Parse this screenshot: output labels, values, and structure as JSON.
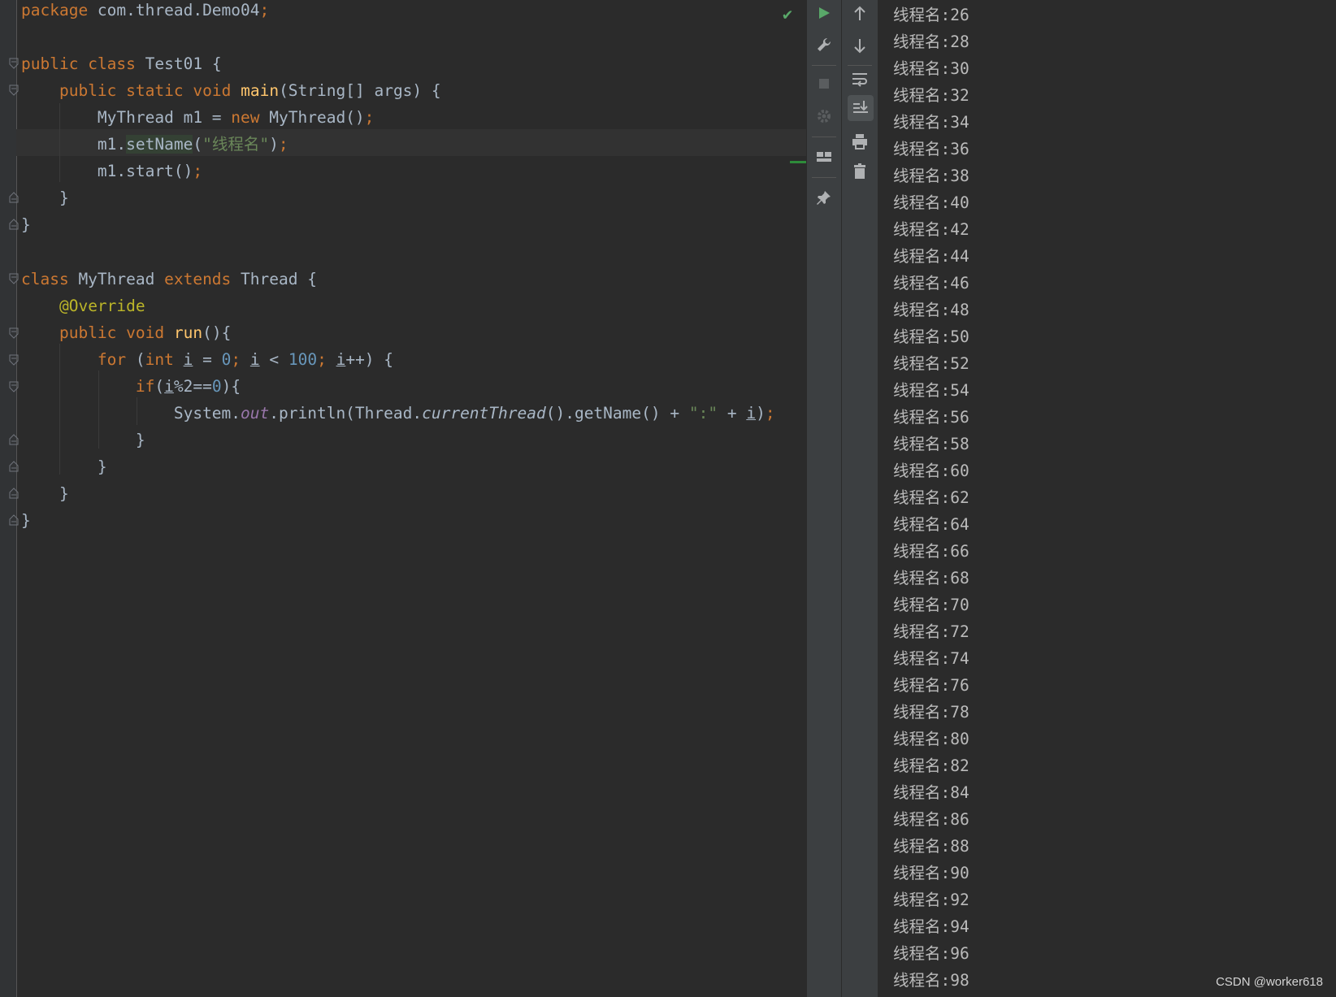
{
  "editor": {
    "lines": [
      {
        "id": "l1"
      },
      {
        "id": "l3"
      }
    ],
    "tokens": {
      "package_kw": "package",
      "package_name": " com.thread.Demo04",
      "semi": ";",
      "public": "public",
      "class": "class",
      "static": "static",
      "void": "void",
      "new": "new",
      "extends": "extends",
      "for": "for",
      "int": "int",
      "if": "if",
      "test01": " Test01 {",
      "main": "main",
      "main_args": "(String[] args) {",
      "mythread_decl": "MyThread m1 = ",
      "mythread_ctor": " MyThread()",
      "m1_dot": "m1.",
      "setName": "setName",
      "paren_open": "(",
      "thread_name_str": "\"线程名\"",
      "paren_close_semi": ")",
      "m1_start": "m1.start()",
      "close_brace": "}",
      "mythread_class": " MyThread ",
      "thread_brace": " Thread {",
      "override": "@Override",
      "run": "run",
      "run_paren": "(){",
      "for_open": " (",
      "i": "i",
      "eq": " = ",
      "zero": "0",
      "lt": " < ",
      "hundred": "100",
      "inc": "++) {",
      "if_open": "(",
      "mod": "%2==",
      "if_close": "){",
      "system": "System.",
      "out": "out",
      "println": ".println(Thread.",
      "currentThread": "currentThread",
      "getname": "().getName() + ",
      "colon_str": "\":\"",
      "plus": " + ",
      "close_paren": ")"
    }
  },
  "console": {
    "lines": [
      "线程名:26",
      "线程名:28",
      "线程名:30",
      "线程名:32",
      "线程名:34",
      "线程名:36",
      "线程名:38",
      "线程名:40",
      "线程名:42",
      "线程名:44",
      "线程名:46",
      "线程名:48",
      "线程名:50",
      "线程名:52",
      "线程名:54",
      "线程名:56",
      "线程名:58",
      "线程名:60",
      "线程名:62",
      "线程名:64",
      "线程名:66",
      "线程名:68",
      "线程名:70",
      "线程名:72",
      "线程名:74",
      "线程名:76",
      "线程名:78",
      "线程名:80",
      "线程名:82",
      "线程名:84",
      "线程名:86",
      "线程名:88",
      "线程名:90",
      "线程名:92",
      "线程名:94",
      "线程名:96",
      "线程名:98"
    ]
  },
  "toolbar": {
    "left": [
      "run-icon",
      "wrench-icon",
      "stop-icon",
      "settings-gear-icon",
      "layout-icon",
      "pin-icon"
    ],
    "right": [
      "up-arrow-icon",
      "down-arrow-icon",
      "soft-wrap-icon",
      "scroll-to-end-icon",
      "print-icon",
      "trash-icon"
    ]
  },
  "watermark": "CSDN @worker618",
  "colors": {
    "background": "#2b2b2b",
    "keyword": "#cc7832",
    "function": "#ffc66d",
    "number": "#6897bb",
    "string": "#6a8759",
    "annotation": "#bbb529",
    "field": "#9876aa",
    "text": "#a9b7c6",
    "run_green": "#59a869"
  }
}
